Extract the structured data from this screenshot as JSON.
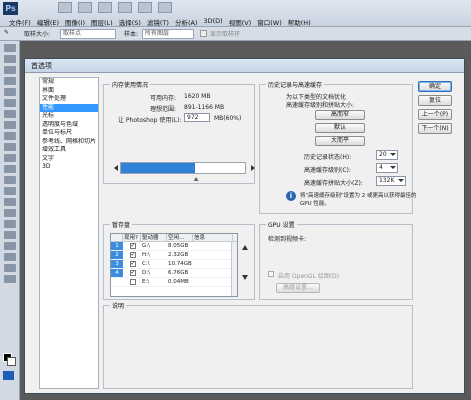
{
  "app": {
    "logo": "Ps",
    "menu": [
      "文件(F)",
      "编辑(E)",
      "图像(I)",
      "图层(L)",
      "选择(S)",
      "滤镜(T)",
      "分析(A)",
      "3D(D)",
      "视图(V)",
      "窗口(W)",
      "帮助(H)"
    ]
  },
  "options_bar": {
    "size_label": "取样大小:",
    "size_value": "取样点",
    "sample_label": "样本:",
    "sample_value": "所有图层",
    "ring_label": "显示取样环"
  },
  "dialog": {
    "title": "首选项",
    "nav_items": [
      "常规",
      "界面",
      "文件处理",
      "性能",
      "光标",
      "透明度与色域",
      "单位与标尺",
      "参考线、网格和切片",
      "增效工具",
      "文字",
      "3D"
    ],
    "active_index": 3
  },
  "memory": {
    "group_label": "内存使用情况",
    "available_label": "可用内存:",
    "available_value": "1620 MB",
    "ideal_label": "理想范围:",
    "ideal_value": "891-1166 MB",
    "let_label": "让 Photoshop 使用(L):",
    "let_value": "972",
    "let_unit": "MB(60%)",
    "usage_fraction": 0.6
  },
  "history": {
    "group_label": "历史记录与高速缓存",
    "optimize_line1": "为以下类型的文档优化",
    "optimize_line2": "高速缓存级别和拼贴大小:",
    "btn_tall": "高而窄",
    "btn_default": "默认",
    "btn_big": "大而平",
    "states_label": "历史记录状态(H):",
    "states_value": "20",
    "levels_label": "高速缓存级别(C):",
    "levels_value": "4",
    "tile_label": "高速缓存拼贴大小(Z):",
    "tile_value": "132K",
    "info_line1": "将\"高速缓存级别\"设置为 2 或更高以获得最佳的",
    "info_line2": "GPU 性能。",
    "info_icon": "i"
  },
  "scratch": {
    "group_label": "暂存盘",
    "headers": [
      "",
      "现用?",
      "驱动器",
      "空闲...",
      "信息"
    ],
    "rows": [
      {
        "num": "1",
        "active": true,
        "drive": "G:\\",
        "free": "8.05GB",
        "info": ""
      },
      {
        "num": "2",
        "active": true,
        "drive": "H:\\",
        "free": "2.32GB",
        "info": ""
      },
      {
        "num": "3",
        "active": true,
        "drive": "C:\\",
        "free": "10.74GB",
        "info": ""
      },
      {
        "num": "4",
        "active": true,
        "drive": "D:\\",
        "free": "6.76GB",
        "info": ""
      },
      {
        "num": "",
        "active": false,
        "drive": "E:\\",
        "free": "0.04MB",
        "info": ""
      }
    ]
  },
  "gpu": {
    "group_label": "GPU 设置",
    "detected_label": "检测到视频卡:",
    "opengl_label": "启用 OpenGL 绘图(D)",
    "advanced_label": "高级设置..."
  },
  "description": {
    "group_label": "说明"
  },
  "actions": {
    "ok": "确定",
    "reset": "复位",
    "prev": "上一个(P)",
    "next": "下一个(N)"
  },
  "colors": {
    "accent": "#3399ff",
    "memory_bar": "#2f82d6",
    "table_index": "#3c8ce0"
  }
}
